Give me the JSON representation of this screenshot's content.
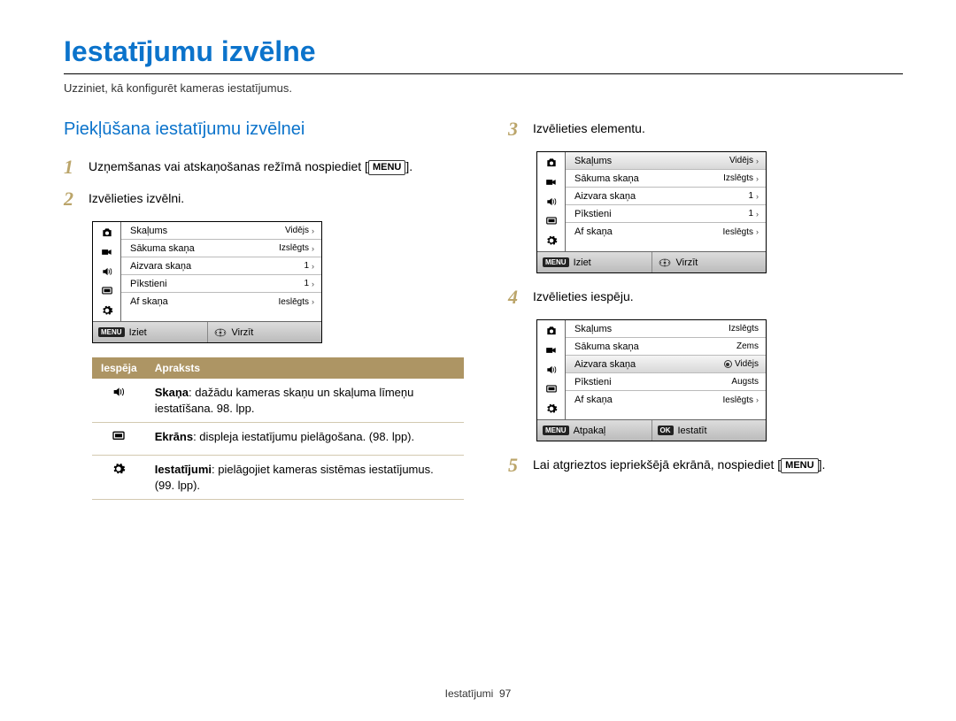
{
  "title": "Iestatījumu izvēlne",
  "subtitle": "Uzziniet, kā konfigurēt kameras iestatījumus.",
  "section_title": "Piekļūšana iestatījumu izvēlnei",
  "menu_button": "MENU",
  "steps": {
    "1": {
      "text_a": "Uzņemšanas vai atskaņošanas režīmā nospiediet [",
      "text_b": "]."
    },
    "2": {
      "text": "Izvēlieties izvēlni."
    },
    "3": {
      "text": "Izvēlieties elementu."
    },
    "4": {
      "text": "Izvēlieties iespēju."
    },
    "5": {
      "text_a": "Lai atgrieztos iepriekšējā ekrānā, nospiediet [",
      "text_b": "]."
    }
  },
  "lcd_common_rows": [
    {
      "label": "Skaļums",
      "value": "Vidējs",
      "arrow": true
    },
    {
      "label": "Sākuma skaņa",
      "value": "Izslēgts",
      "arrow": true
    },
    {
      "label": "Aizvara skaņa",
      "value": "1",
      "arrow": true
    },
    {
      "label": "Pīkstieni",
      "value": "1",
      "arrow": true
    },
    {
      "label": "Af skaņa",
      "value": "Ieslēgts",
      "arrow": true
    }
  ],
  "lcd_step4_rows": [
    {
      "label": "Skaļums",
      "popup": "Izslēgts"
    },
    {
      "label": "Sākuma skaņa",
      "popup": "Zems"
    },
    {
      "label": "Aizvara skaņa",
      "popup": "Vidējs",
      "selected": true
    },
    {
      "label": "Pīkstieni",
      "popup": "Augsts"
    },
    {
      "label": "Af skaņa",
      "value": "Ieslēgts",
      "arrow": true
    }
  ],
  "lcd_footer_a": {
    "left_badge": "MENU",
    "left_text": "Iziet",
    "right_text": "Virzīt"
  },
  "lcd_footer_b": {
    "left_badge": "MENU",
    "left_text": "Atpakaļ",
    "right_badge": "OK",
    "right_text": "Iestatīt"
  },
  "options_table": {
    "headers": {
      "opt": "Iespēja",
      "desc": "Apraksts"
    },
    "rows": [
      {
        "icon": "sound",
        "label": "Skaņa",
        "desc": ": dažādu kameras skaņu un skaļuma līmeņu iestatīšana. 98. lpp."
      },
      {
        "icon": "display",
        "label": "Ekrāns",
        "desc": ": displeja iestatījumu pielāgošana. (98. lpp)."
      },
      {
        "icon": "gear",
        "label": "Iestatījumi",
        "desc": ": pielāgojiet kameras sistēmas iestatījumus. (99. lpp)."
      }
    ]
  },
  "footer": {
    "section": "Iestatījumi",
    "page": "97"
  }
}
